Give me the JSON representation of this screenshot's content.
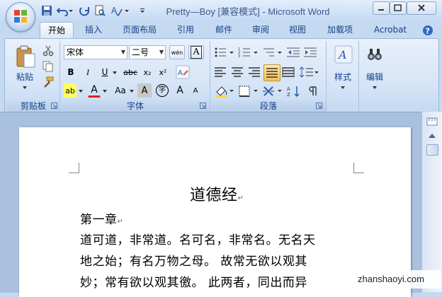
{
  "window": {
    "title": "Pretty—Boy [兼容模式] - Microsoft Word"
  },
  "tabs": [
    "开始",
    "插入",
    "页面布局",
    "引用",
    "邮件",
    "审阅",
    "视图",
    "加载项",
    "Acrobat"
  ],
  "ribbon": {
    "clipboard": {
      "label": "剪贴板",
      "paste_label": "粘贴"
    },
    "font": {
      "label": "字体",
      "font_name": "宋体",
      "font_size": "二号",
      "wen_label": "wén",
      "bold": "B",
      "italic": "I",
      "underline": "U",
      "strike": "abc",
      "subscript": "x₂",
      "superscript": "x²",
      "clear": "Aa",
      "char_shade": "A",
      "enclose": "字",
      "grow": "A",
      "shrink": "A",
      "highlight": "ab",
      "font_color": "A",
      "char_border": "A"
    },
    "paragraph": {
      "label": "段落"
    },
    "styles": {
      "label": "样式"
    },
    "editing": {
      "label": "编辑"
    }
  },
  "document": {
    "title": "道德经",
    "chapter": "第一章",
    "lines": [
      "道可道，非常道。名可名，非常名。无名天",
      "地之始；有名万物之母。 故常无欲以观其",
      "妙；常有欲以观其徼。 此两者，同出而异"
    ],
    "para_mark": "↵"
  },
  "watermark": "zhanshaoyi.com",
  "colors": {
    "accent": "#15428b",
    "ribbon_bg": "#dce8f7",
    "doc_bg": "#a9c0de"
  }
}
